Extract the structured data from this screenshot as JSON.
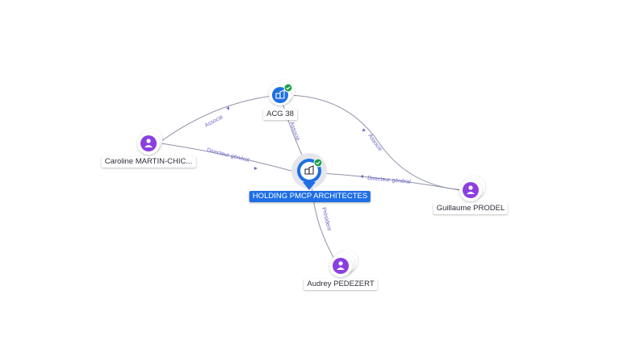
{
  "colors": {
    "person_node": "#8b3fe0",
    "company_node": "#1f6fe5",
    "main_node": "#1f6fe5",
    "verified_badge": "#1c9f4a",
    "edge": "#8e93a8",
    "edge_label": "#6a64c9"
  },
  "nodes": {
    "main": {
      "label": "HOLDING PMCP ARCHITECTES",
      "icon": "building-icon",
      "verified": true
    },
    "acg": {
      "label": "ACG 38",
      "icon": "building-icon",
      "verified": true
    },
    "caroline": {
      "label": "Caroline MARTIN-CHIC...",
      "icon": "person-icon"
    },
    "guillaume": {
      "label": "Guillaume PRODEL",
      "icon": "person-icon"
    },
    "audrey": {
      "label": "Audrey PEDEZERT",
      "icon": "person-icon"
    }
  },
  "edges": {
    "caroline_acg": "Associé",
    "acg_main": "Associé",
    "acg_guillaume": "Associé",
    "caroline_main": "Directeur général",
    "guillaume_main": "Directeur général",
    "audrey_main": "Président"
  }
}
